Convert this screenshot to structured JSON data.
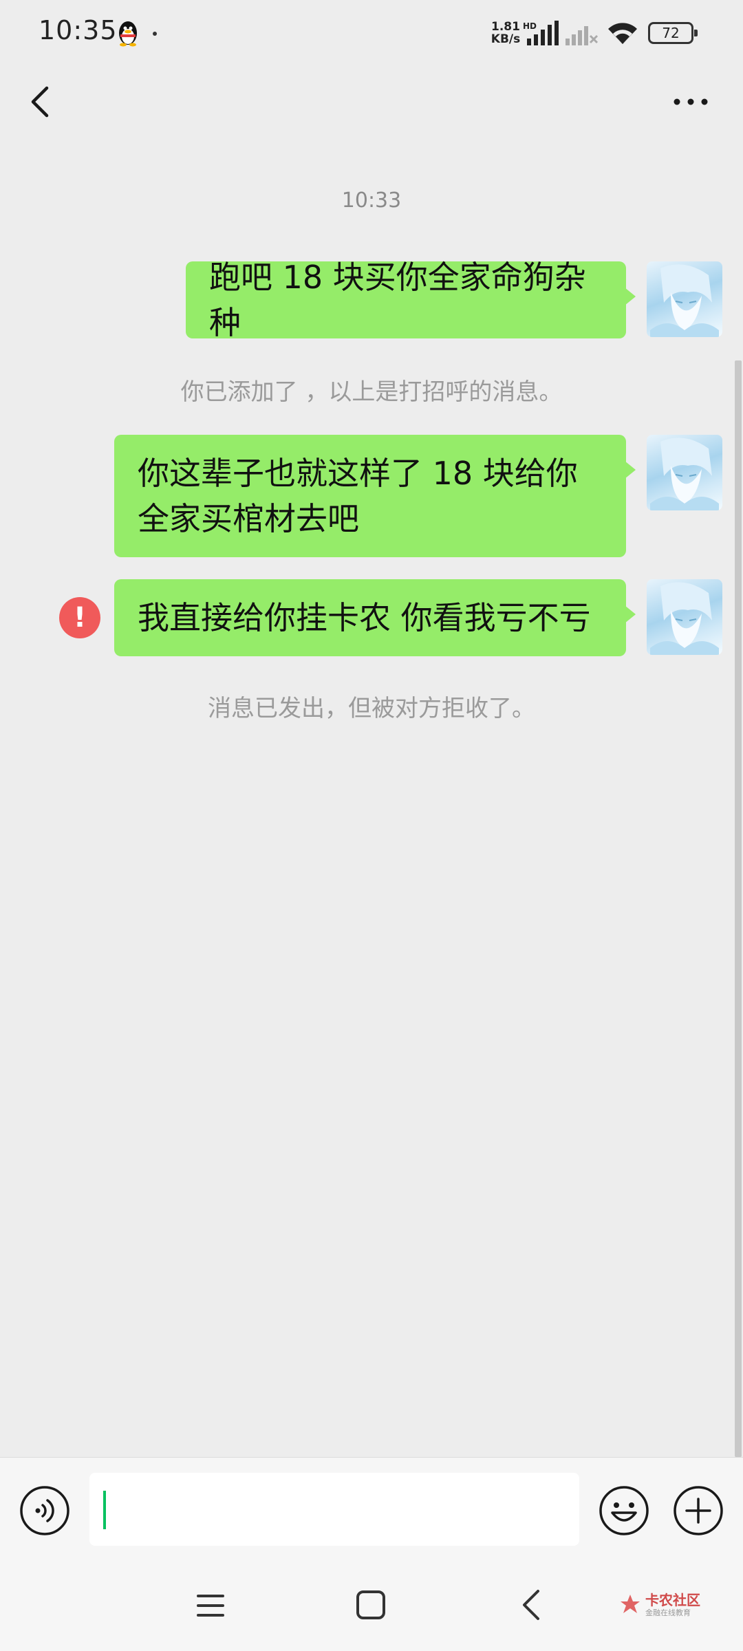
{
  "status_bar": {
    "time": "10:35",
    "net_speed_value": "1.81",
    "net_speed_unit": "KB/s",
    "signal_label": "HD",
    "battery": "72"
  },
  "chat": {
    "timestamp": "10:33",
    "messages": [
      {
        "text": "跑吧 18 块买你全家命狗杂种",
        "failed": false
      },
      {
        "text": "你这辈子也就这样了 18 块给你全家买棺材去吧",
        "failed": false
      },
      {
        "text": "我直接给你挂卡农 你看我亏不亏",
        "failed": true
      }
    ],
    "notice_greeting": "你已添加了    ，以上是打招呼的消息。",
    "notice_rejected": "消息已发出，但被对方拒收了。",
    "error_mark": "!"
  },
  "input": {
    "value": ""
  },
  "watermark": {
    "brand": "卡农社区",
    "slogan": "金融在线教育"
  },
  "icons": {
    "back": "chevron-left-icon",
    "more": "more-dots-icon",
    "voice": "voice-icon",
    "emoji": "emoji-icon",
    "plus": "plus-icon"
  },
  "colors": {
    "bubble": "#95ec69",
    "background": "#ededed",
    "error": "#f05a5a",
    "caret": "#07c160"
  }
}
